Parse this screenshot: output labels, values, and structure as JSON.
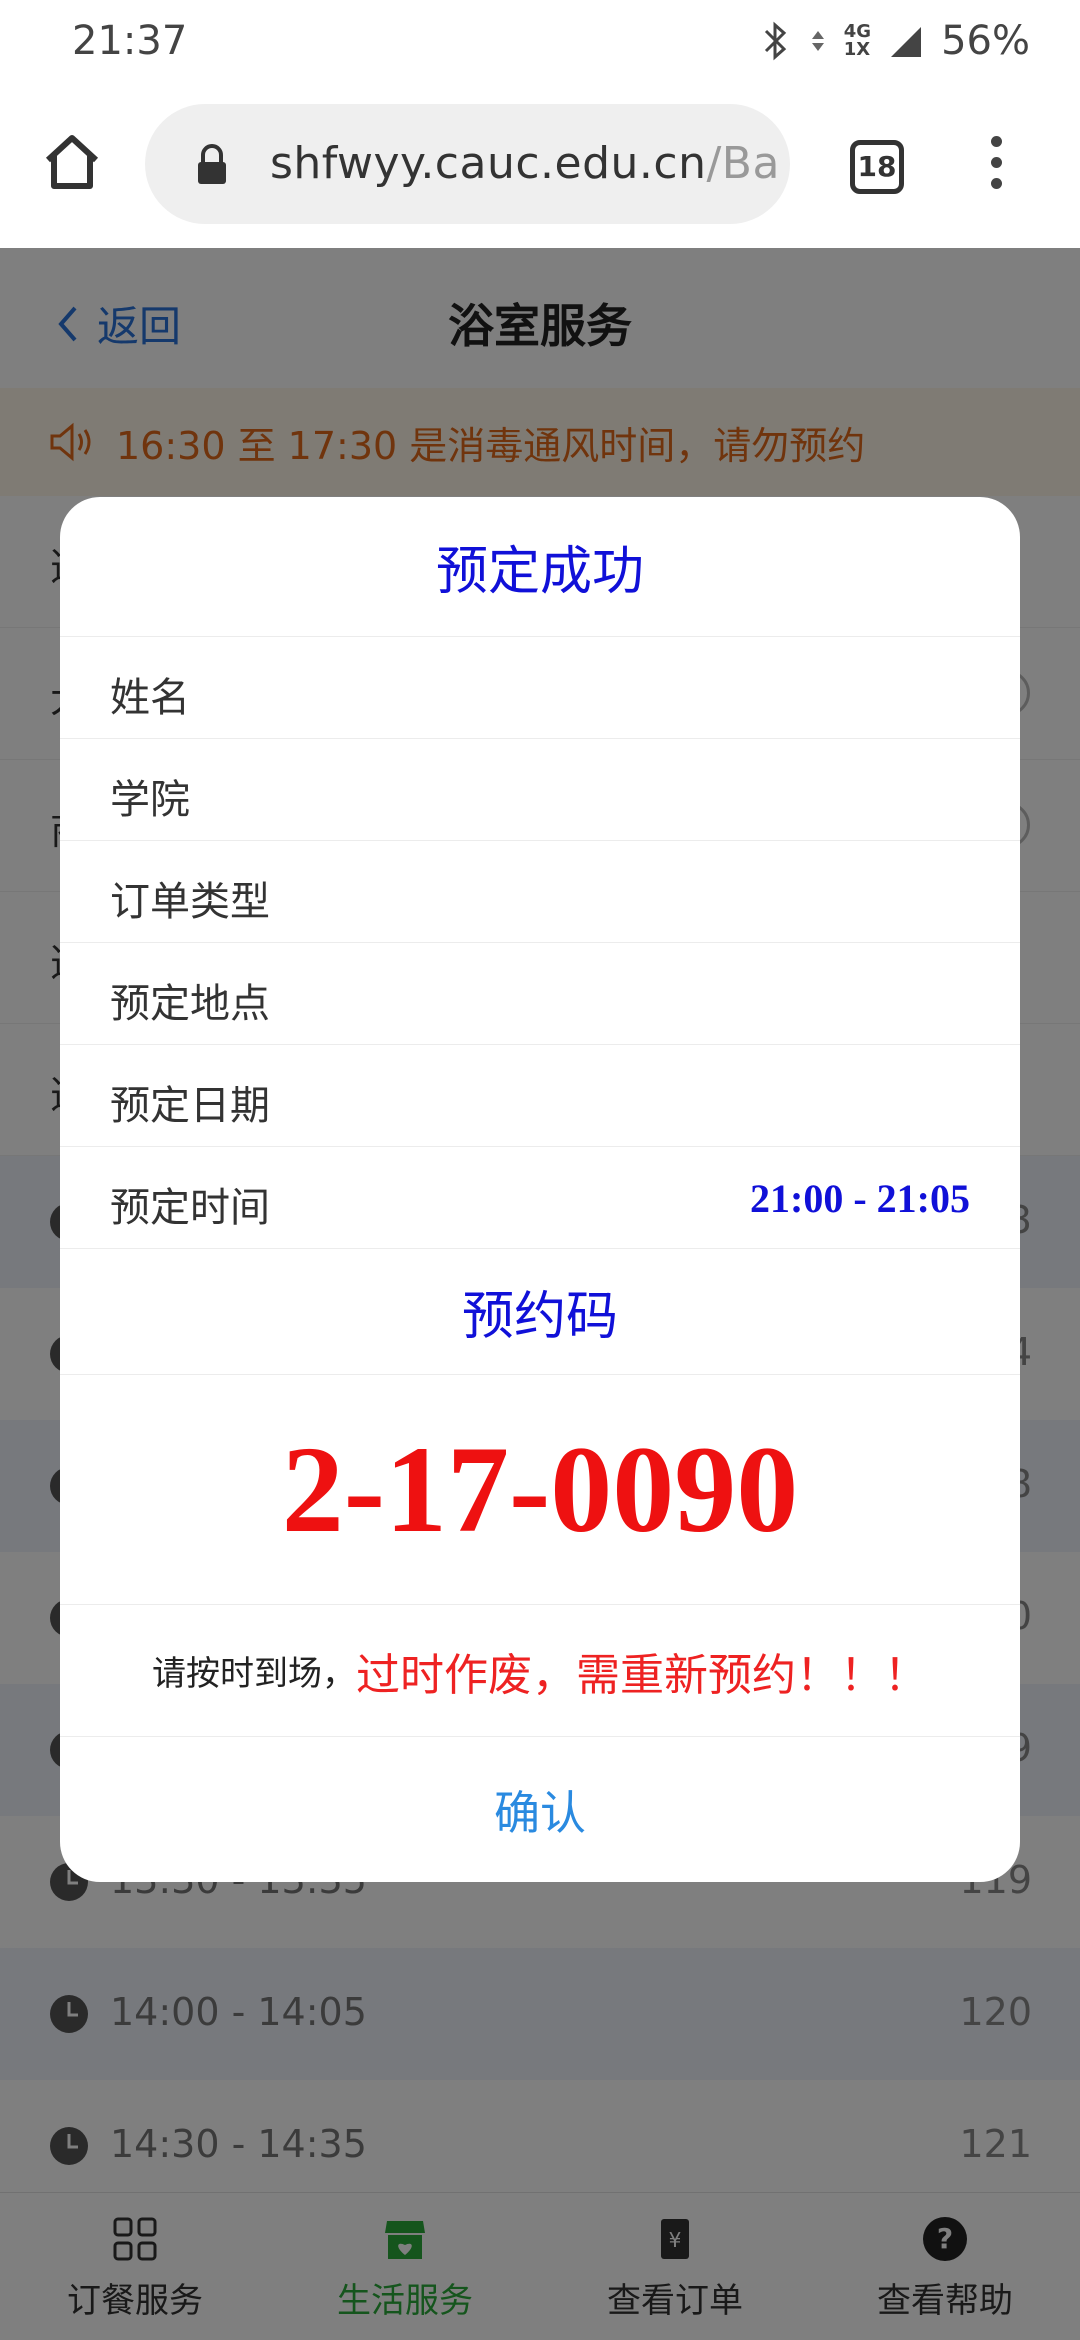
{
  "status": {
    "time": "21:37",
    "network": "4G",
    "network2": "1X",
    "battery": "56%"
  },
  "browser": {
    "url_main": "shfwyy.cauc.edu.cn",
    "url_tail": "/Ba",
    "tab_count": "18"
  },
  "page": {
    "back_label": "返回",
    "title": "浴室服务",
    "notice": "16:30 至 17:30 是消毒通风时间，请勿预约",
    "rows": [
      "选",
      "大",
      "商",
      "选",
      "选"
    ],
    "slots": [
      {
        "time": "",
        "num": "3"
      },
      {
        "time": "",
        "num": "4"
      },
      {
        "time": "",
        "num": "8"
      },
      {
        "time": "",
        "num": "0"
      },
      {
        "time": "",
        "num": "9"
      },
      {
        "time": "13:30 - 13:35",
        "num": "119"
      },
      {
        "time": "14:00 - 14:05",
        "num": "120"
      },
      {
        "time": "14:30 - 14:35",
        "num": "121"
      }
    ]
  },
  "tabbar": [
    {
      "label": "订餐服务",
      "icon": "grid-icon"
    },
    {
      "label": "生活服务",
      "icon": "shop-icon"
    },
    {
      "label": "查看订单",
      "icon": "order-icon"
    },
    {
      "label": "查看帮助",
      "icon": "help-icon"
    }
  ],
  "dialog": {
    "title": "预定成功",
    "fields": [
      {
        "label": "姓名",
        "value": ""
      },
      {
        "label": "学院",
        "value": ""
      },
      {
        "label": "订单类型",
        "value": ""
      },
      {
        "label": "预定地点",
        "value": ""
      },
      {
        "label": "预定日期",
        "value": ""
      },
      {
        "label": "预定时间",
        "value": "21:00 - 21:05"
      }
    ],
    "code_label": "预约码",
    "code": "2-17-0090",
    "warn_prefix": "请按时到场，",
    "warn_red": "过时作废，需重新预约！！！",
    "confirm": "确认"
  },
  "colors": {
    "accent_blue": "#1010d8",
    "code_red": "#ee1111",
    "link_blue": "#2a8ae0",
    "active_green": "#2bab3a"
  }
}
